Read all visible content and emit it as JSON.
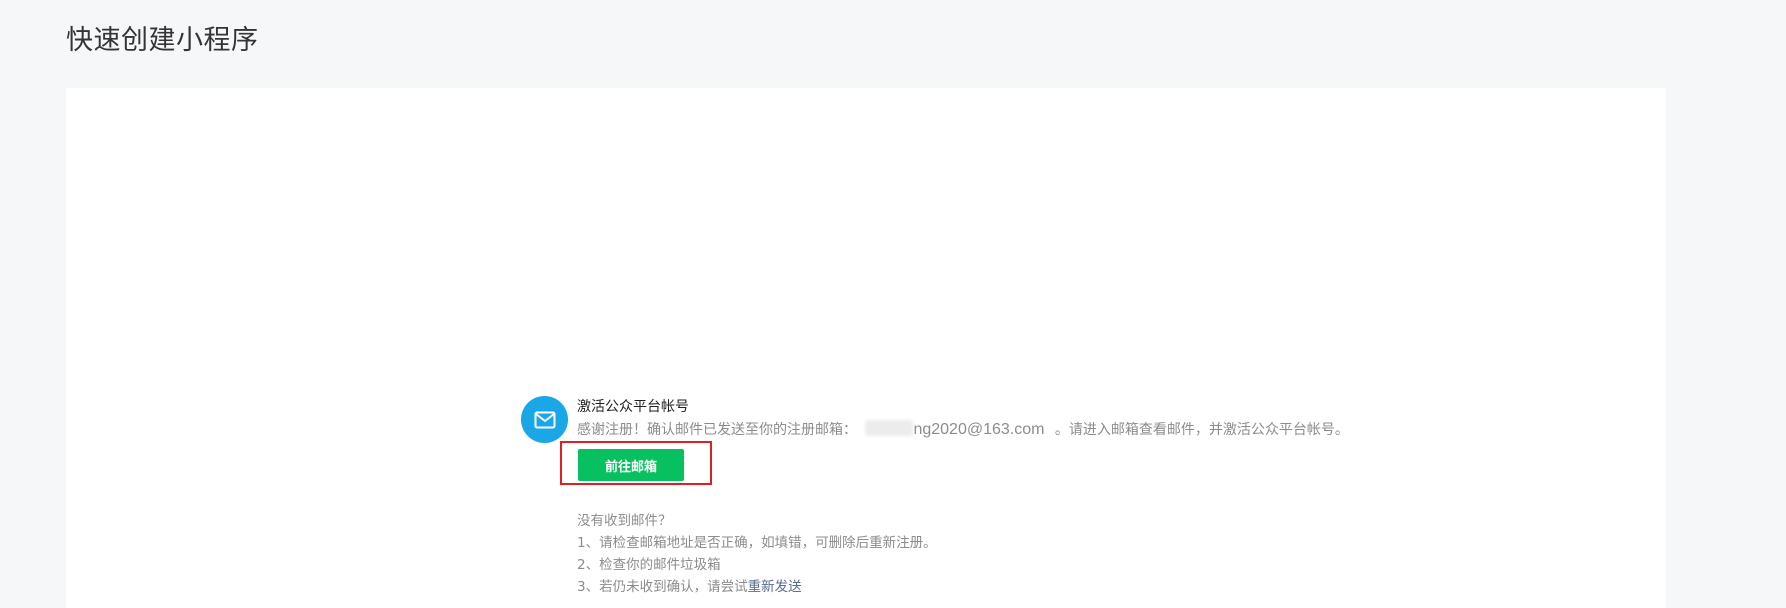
{
  "page": {
    "title": "快速创建小程序"
  },
  "notice": {
    "icon": "mail-icon",
    "title": "激活公众平台帐号",
    "desc_prefix": "感谢注册！确认邮件已发送至你的注册邮箱：",
    "email_visible": "ng2020@163.com",
    "desc_suffix": "。请进入邮箱查看邮件，并激活公众平台帐号。",
    "button_label": "前往邮箱"
  },
  "help": {
    "heading": "没有收到邮件？",
    "items": [
      "1、请检查邮箱地址是否正确，如填错，可删除后重新注册。",
      "2、检查你的邮件垃圾箱"
    ],
    "item3_prefix": "3、若仍未收到确认，请尝试",
    "resend_label": "重新发送"
  },
  "colors": {
    "accent_green": "#07c160",
    "icon_blue": "#1aa7e8",
    "link": "#576b95",
    "highlight_red": "#e02020"
  }
}
